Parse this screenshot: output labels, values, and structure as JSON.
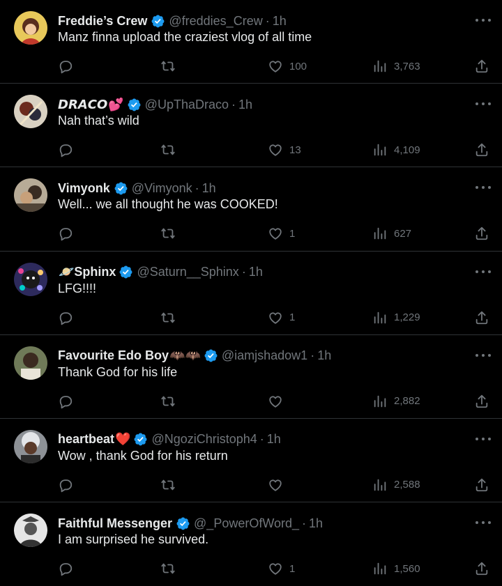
{
  "replies": [
    {
      "name": "Freddie’s Crew",
      "name_emoji": "",
      "handle": "@freddies_Crew",
      "time": "1h",
      "text": "Manz finna upload the craziest vlog of all time",
      "replies": "",
      "retweets": "",
      "likes": "100",
      "views": "3,763",
      "avatar_color": "#e8c85a"
    },
    {
      "name": "𝘿𝙍𝘼𝘾𝙊",
      "name_emoji": "💕",
      "handle": "@UpThaDraco",
      "time": "1h",
      "text": "Nah that’s wild",
      "replies": "",
      "retweets": "",
      "likes": "13",
      "views": "4,109",
      "avatar_color": "#c9b9a2"
    },
    {
      "name": "Vimyonk",
      "name_emoji": "",
      "handle": "@Vimyonk",
      "time": "1h",
      "text": "Well... we all thought he was COOKED!",
      "replies": "",
      "retweets": "",
      "likes": "1",
      "views": "627",
      "avatar_color": "#a89a86"
    },
    {
      "name": "Sphinx",
      "name_emoji": "🪐",
      "handle": "@Saturn__Sphinx",
      "time": "1h",
      "text": "LFG!!!!",
      "replies": "",
      "retweets": "",
      "likes": "1",
      "views": "1,229",
      "avatar_color": "#3c3a78"
    },
    {
      "name": "Favourite Edo Boy",
      "name_emoji": "🦇🦇",
      "handle": "@iamjshadow1",
      "time": "1h",
      "text": "Thank God for his life",
      "replies": "",
      "retweets": "",
      "likes": "",
      "views": "2,882",
      "avatar_color": "#5f6b4a"
    },
    {
      "name": "heartbeat",
      "name_emoji": "❤️",
      "handle": "@NgoziChristoph4",
      "time": "1h",
      "text": "Wow , thank God for his return",
      "replies": "",
      "retweets": "",
      "likes": "",
      "views": "2,588",
      "avatar_color": "#9fa3a8"
    },
    {
      "name": "Faithful Messenger",
      "name_emoji": "",
      "handle": "@_PowerOfWord_",
      "time": "1h",
      "text": "I am surprised he survived.",
      "replies": "",
      "retweets": "",
      "likes": "1",
      "views": "1,560",
      "avatar_color": "#d8d8d8"
    }
  ],
  "separator": "·",
  "colors": {
    "background": "#000000",
    "text": "#e7e9ea",
    "muted": "#71767b",
    "verified": "#1d9bf0",
    "divider": "#2f3336"
  },
  "icons": {
    "verified": "verified-badge-icon",
    "reply": "reply-icon",
    "retweet": "retweet-icon",
    "like": "heart-icon",
    "views": "views-icon",
    "share": "share-icon",
    "more": "more-icon"
  }
}
